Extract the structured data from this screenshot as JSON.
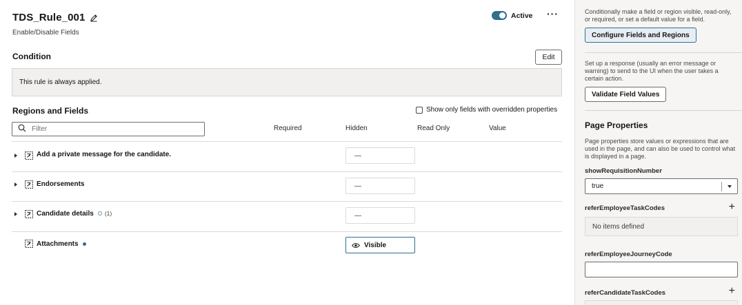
{
  "header": {
    "title": "TDS_Rule_001",
    "subtitle": "Enable/Disable Fields",
    "active_label": "Active",
    "active_on": true,
    "more_label": "···"
  },
  "condition": {
    "title": "Condition",
    "edit_label": "Edit",
    "text": "This rule is always applied."
  },
  "regions": {
    "title": "Regions and Fields",
    "show_overridden_label": "Show only fields with overridden properties",
    "filter_placeholder": "Filter",
    "columns": [
      "Required",
      "Hidden",
      "Read Only",
      "Value"
    ],
    "rows": [
      {
        "label": "Add a private message for the candidate.",
        "hidden": "—",
        "expandable": true
      },
      {
        "label": "Endorsements",
        "hidden": "—",
        "expandable": true
      },
      {
        "label": "Candidate details",
        "hidden": "—",
        "expandable": true,
        "count": "(1)"
      },
      {
        "label": "Attachments",
        "hidden": "Visible",
        "expandable": false
      }
    ]
  },
  "sidebar": {
    "configure_desc": "Conditionally make a field or region visible, read-only, or required, or set a default value for a field.",
    "configure_label": "Configure Fields and Regions",
    "validate_desc": "Set up a response (usually an error message or warning) to send to the UI when the user takes a certain action.",
    "validate_label": "Validate Field Values",
    "page_properties_title": "Page Properties",
    "page_properties_desc": "Page properties store values or expressions that are used in the page, and can also be used to control what is displayed in a page.",
    "props": {
      "show_req_label": "showRequisitionNumber",
      "show_req_value": "true",
      "refer_emp_task_label": "referEmployeeTaskCodes",
      "no_items": "No items defined",
      "refer_emp_journey_label": "referEmployeeJourneyCode",
      "refer_cand_task_label": "referCandidateTaskCodes"
    },
    "plus": "+"
  },
  "colors": {
    "accent": "#2f6f8f",
    "toggle_on": "#2f6f8f"
  }
}
